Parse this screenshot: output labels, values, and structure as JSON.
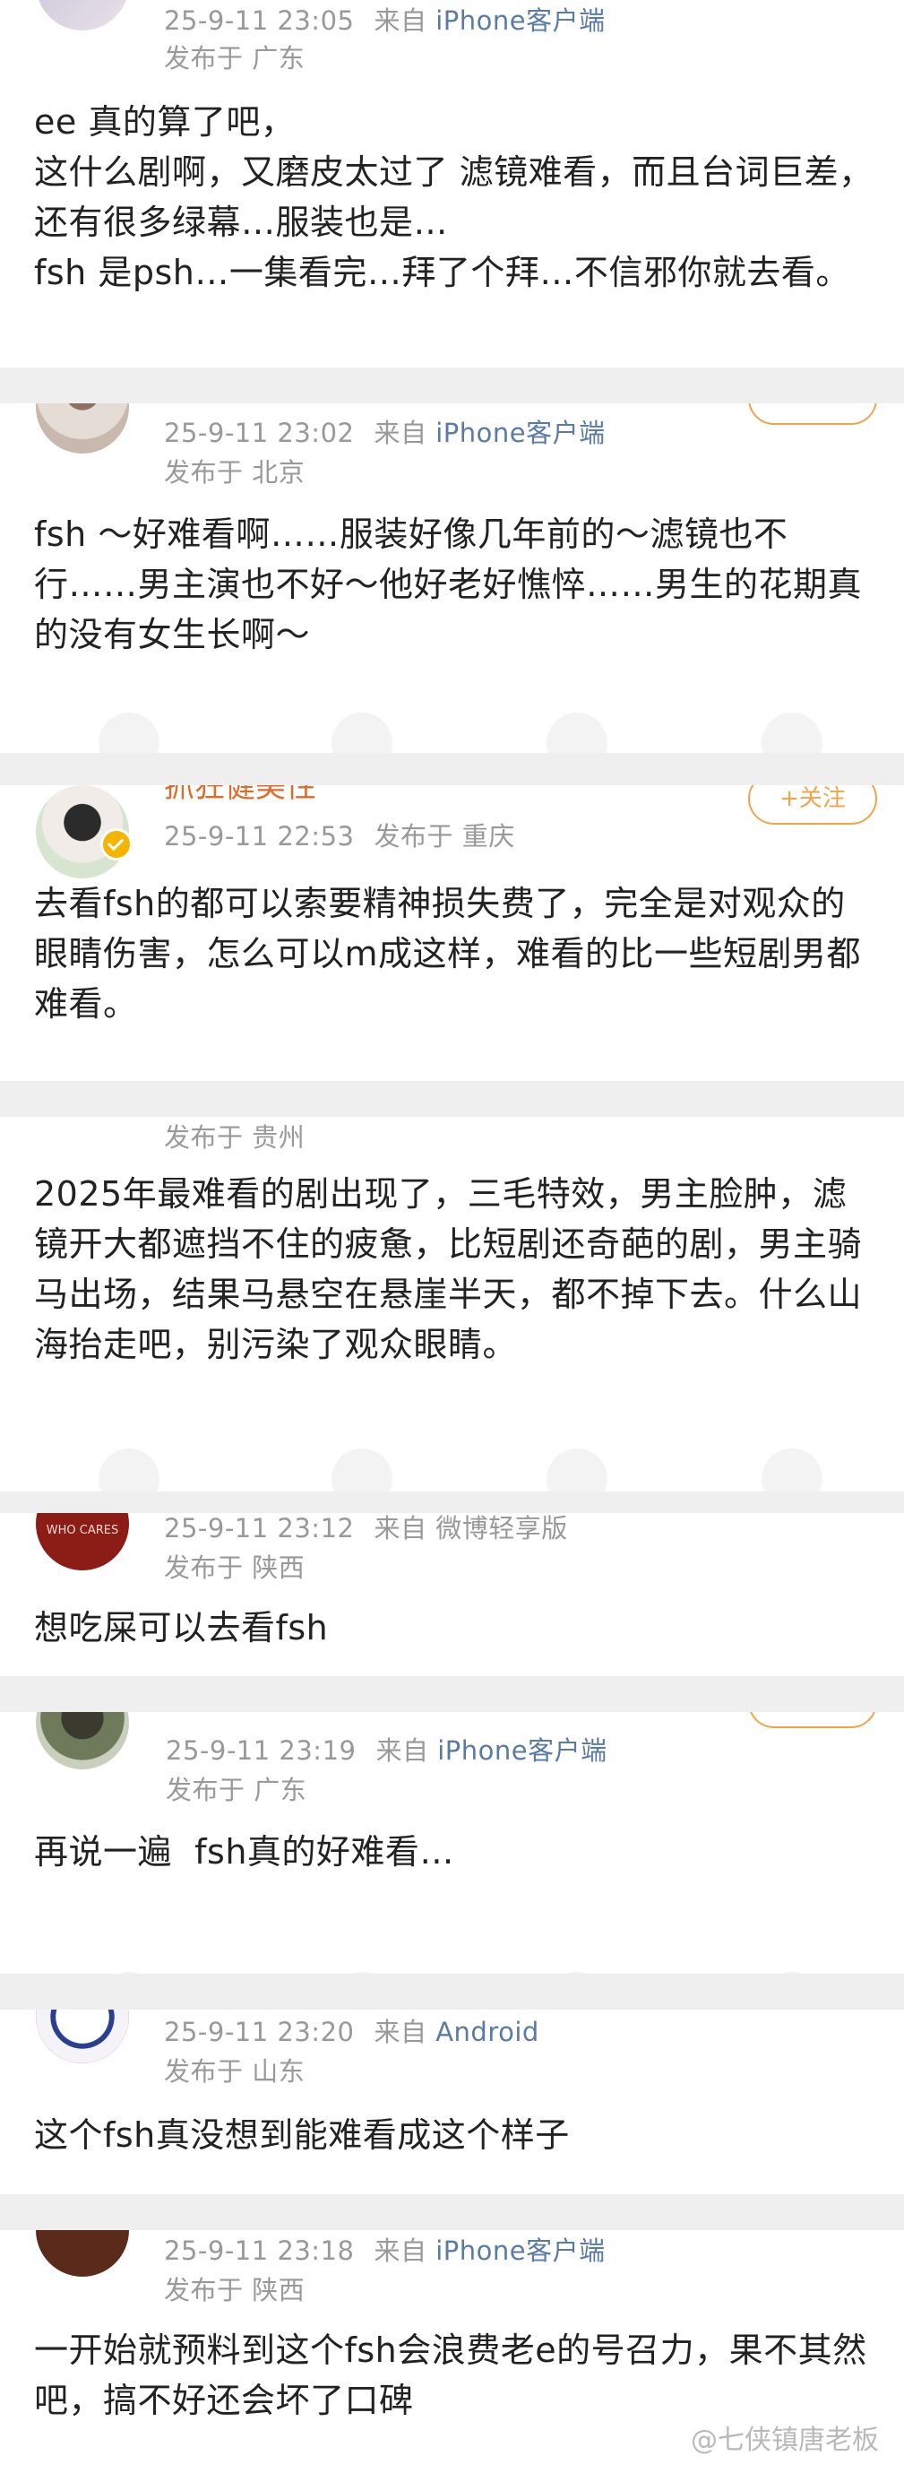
{
  "comments": [
    {
      "time": "25-9-11 23:05",
      "source_prefix": "来自",
      "source": "iPhone客户端",
      "location": "发布于 广东",
      "text": "ee 真的算了吧，\n这什么剧啊，又磨皮太过了 滤镜难看，而且台词巨差，还有很多绿幕…服装也是…\nfsh 是psh…一集看完…拜了个拜…不信邪你就去看。"
    },
    {
      "time": "25-9-11 23:02",
      "source_prefix": "来自",
      "source": "iPhone客户端",
      "location": "发布于 北京",
      "text": "fsh ～好难看啊……服装好像几年前的～滤镜也不行……男主演也不好～他好老好憔悴……男生的花期真的没有女生长啊～"
    },
    {
      "name_partial": "抓狂健美性",
      "follow_label": "+关注",
      "time": "25-9-11 22:53",
      "location": "发布于 重庆",
      "text": "去看fsh的都可以索要精神损失费了，完全是对观众的眼睛伤害，怎么可以m成这样，难看的比一些短剧男都难看。"
    },
    {
      "location": "发布于 贵州",
      "text": "2025年最难看的剧出现了，三毛特效，男主脸肿，滤镜开大都遮挡不住的疲惫，比短剧还奇葩的剧，男主骑马出场，结果马悬空在悬崖半天，都不掉下去。什么山海抬走吧，别污染了观众眼睛。"
    },
    {
      "avatar_text": "WHO CARES",
      "time": "25-9-11 23:12",
      "source_prefix": "来自",
      "source": "微博轻享版",
      "location": "发布于 陕西",
      "text": "想吃屎可以去看fsh"
    },
    {
      "time": "25-9-11 23:19",
      "source_prefix": "来自",
      "source": "iPhone客户端",
      "location": "发布于 广东",
      "text": "再说一遍  fsh真的好难看…"
    },
    {
      "time": "25-9-11 23:20",
      "source_prefix": "来自",
      "source": "Android",
      "location": "发布于 山东",
      "text": "这个fsh真没想到能难看成这个样子"
    },
    {
      "time": "25-9-11 23:18",
      "source_prefix": "来自",
      "source": "iPhone客户端",
      "location": "发布于 陕西",
      "text": "一开始就预料到这个fsh会浪费老e的号召力，果不其然吧，搞不好还会坏了口碑"
    }
  ],
  "watermark": "@七侠镇唐老板",
  "colors": {
    "source_link": "#5a7ba6",
    "meta_gray": "#999999",
    "follow_orange": "#f0a44a",
    "separator": "#efefef"
  }
}
